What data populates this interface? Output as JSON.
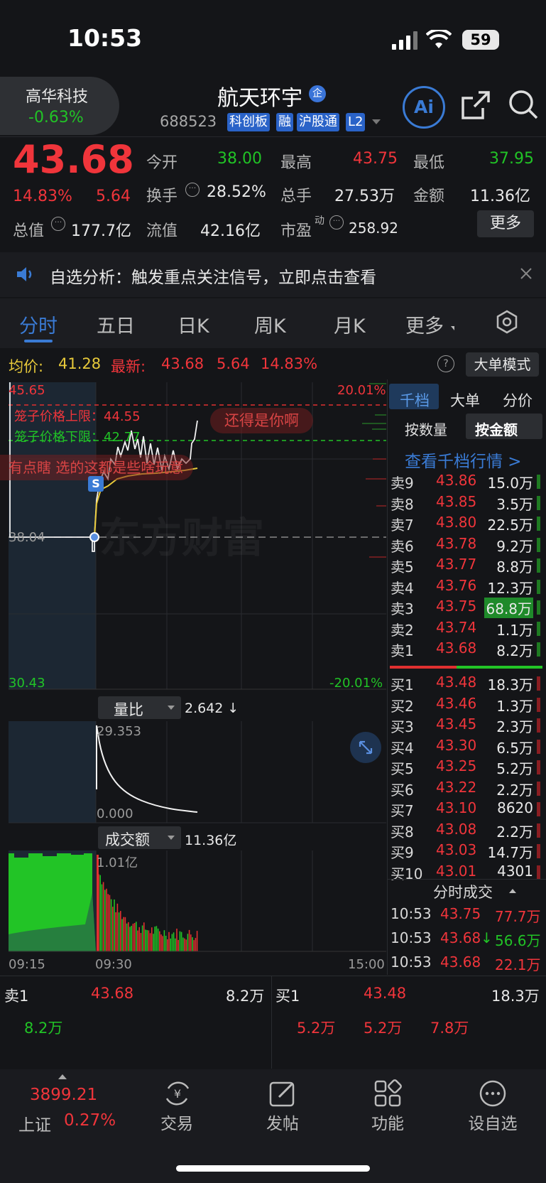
{
  "status": {
    "time": "10:53",
    "battery": "59"
  },
  "header": {
    "back_name": "高华科技",
    "back_pct": "-0.63%",
    "title": "航天环宇",
    "title_badge": "企",
    "code": "688523",
    "tags": [
      "科创板",
      "融",
      "沪股通",
      "L2"
    ],
    "ai_label": "Ai"
  },
  "quote": {
    "price": "43.68",
    "pct": "14.83%",
    "change": "5.64",
    "open_label": "今开",
    "open": "38.00",
    "high_label": "最高",
    "high": "43.75",
    "low_label": "最低",
    "low": "37.95",
    "turnover_label": "换手",
    "turnover": "28.52%",
    "volume_label": "总手",
    "volume": "27.53万",
    "amount_label": "金额",
    "amount": "11.36亿",
    "mktcap_label": "总值",
    "mktcap": "177.7亿",
    "float_label": "流值",
    "float_cap": "42.16亿",
    "pe_label": "市盈",
    "pe_sup": "动",
    "pe": "258.92",
    "more": "更多"
  },
  "banner": {
    "text": "自选分析：触发重点关注信号，立即点击查看"
  },
  "tabs": [
    "分时",
    "五日",
    "日K",
    "周K",
    "月K",
    "更多"
  ],
  "info": {
    "avg_label": "均价:",
    "avg": "41.28",
    "latest_label": "最新:",
    "latest": "43.68",
    "change": "5.64",
    "pct": "14.83%",
    "mode": "大单模式"
  },
  "chart": {
    "top_price": "45.65",
    "bottom_price": "30.43",
    "mid_price": "38.04",
    "top_pct": "20.01%",
    "bottom_pct": "-20.01%",
    "upper_limit": "笼子价格上限：44.55",
    "lower_limit": "笼子价格下限：42.77",
    "danmu1": "还得是你啊",
    "danmu2": "有点瞎 选的这都是些啥玩意",
    "watermark": "东方财富",
    "marker": "S",
    "ratio_label": "量比",
    "ratio_value": "2.642 ↓",
    "ratio_max": "29.353",
    "ratio_min": "0.000",
    "amount_label": "成交额",
    "amount_value": "11.36亿",
    "amount_max": "1.01亿",
    "times": [
      "09:15",
      "09:30",
      "15:00"
    ]
  },
  "orderbook": {
    "tabs": [
      "千档",
      "大单",
      "分价"
    ],
    "subtabs": [
      "按数量",
      "按金额"
    ],
    "link": "查看千档行情 >",
    "asks": [
      {
        "label": "卖9",
        "price": "43.86",
        "vol": "15.0万"
      },
      {
        "label": "卖8",
        "price": "43.85",
        "vol": "3.5万"
      },
      {
        "label": "卖7",
        "price": "43.80",
        "vol": "22.5万"
      },
      {
        "label": "卖6",
        "price": "43.78",
        "vol": "9.2万"
      },
      {
        "label": "卖5",
        "price": "43.77",
        "vol": "8.8万"
      },
      {
        "label": "卖4",
        "price": "43.76",
        "vol": "12.3万"
      },
      {
        "label": "卖3",
        "price": "43.75",
        "vol": "68.8万"
      },
      {
        "label": "卖2",
        "price": "43.74",
        "vol": "1.1万"
      },
      {
        "label": "卖1",
        "price": "43.68",
        "vol": "8.2万"
      }
    ],
    "bids": [
      {
        "label": "买1",
        "price": "43.48",
        "vol": "18.3万"
      },
      {
        "label": "买2",
        "price": "43.46",
        "vol": "1.3万"
      },
      {
        "label": "买3",
        "price": "43.45",
        "vol": "2.3万"
      },
      {
        "label": "买4",
        "price": "43.30",
        "vol": "6.5万"
      },
      {
        "label": "买5",
        "price": "43.25",
        "vol": "5.2万"
      },
      {
        "label": "买6",
        "price": "43.22",
        "vol": "2.2万"
      },
      {
        "label": "买7",
        "price": "43.10",
        "vol": "8620"
      },
      {
        "label": "买8",
        "price": "43.08",
        "vol": "2.2万"
      },
      {
        "label": "买9",
        "price": "43.03",
        "vol": "14.7万"
      },
      {
        "label": "买10",
        "price": "43.01",
        "vol": "4301"
      }
    ],
    "trades_title": "分时成交",
    "trades": [
      {
        "time": "10:53",
        "price": "43.75",
        "vol": "77.7万",
        "dir": ""
      },
      {
        "time": "10:53",
        "price": "43.68",
        "vol": "56.6万",
        "dir": "↓"
      },
      {
        "time": "10:53",
        "price": "43.68",
        "vol": "22.1万",
        "dir": ""
      }
    ]
  },
  "level": {
    "sell_label": "卖1",
    "sell_price": "43.68",
    "sell_vol": "8.2万",
    "sell_detail": "8.2万",
    "buy_label": "买1",
    "buy_price": "43.48",
    "buy_vol": "18.3万",
    "buy_details": [
      "5.2万",
      "5.2万",
      "7.8万"
    ]
  },
  "nav": {
    "index_value": "3899.21",
    "index_name": "上证",
    "index_pct": "0.27%",
    "items": [
      "交易",
      "发帖",
      "功能",
      "设自选"
    ]
  }
}
